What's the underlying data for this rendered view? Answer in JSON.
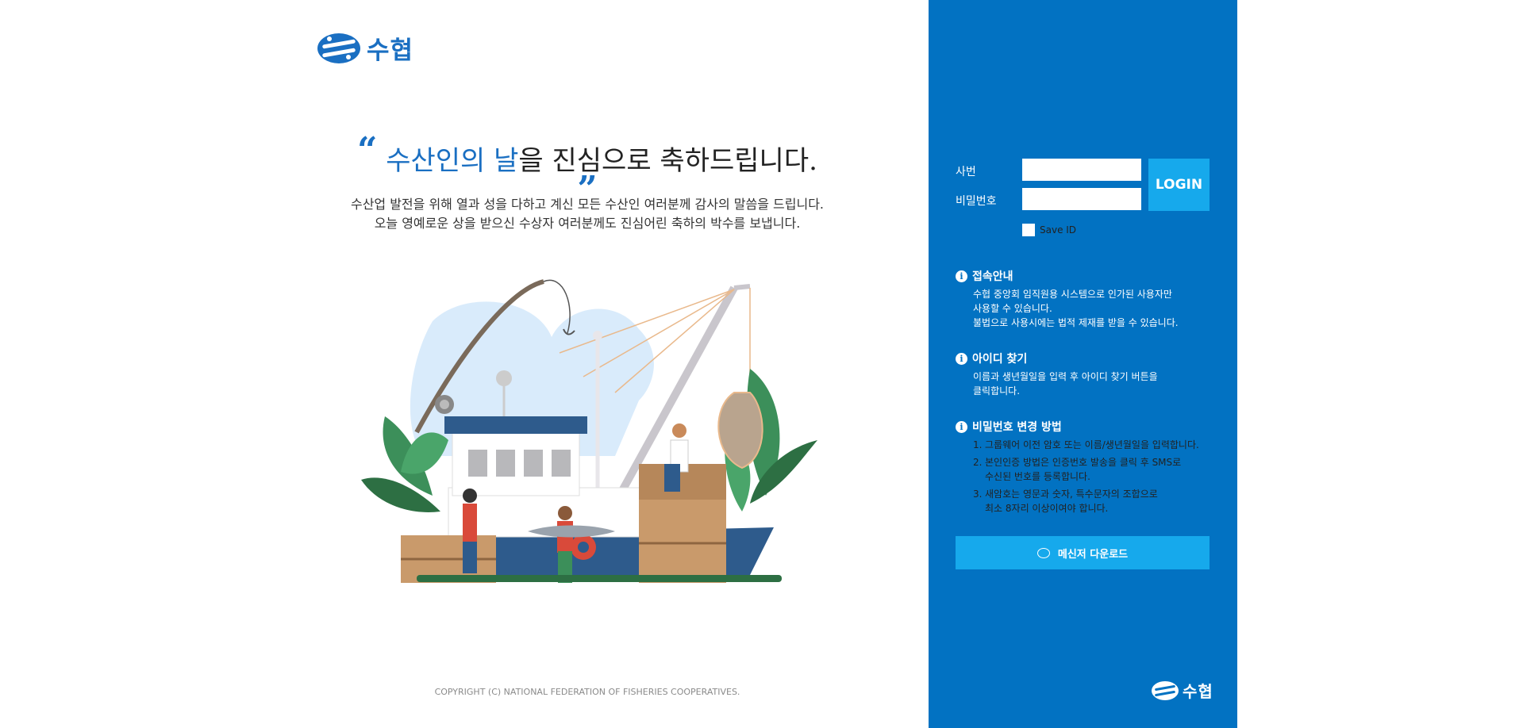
{
  "brand": {
    "logo_text": "수협",
    "primary_color": "#1a6fc2",
    "panel_color": "#0272c2",
    "button_color": "#16a9ec"
  },
  "headline": {
    "accent": "수산인의 날",
    "rest": "을 진심으로 축하드립니다."
  },
  "subtext": {
    "line1": "수산업 발전을 위해 열과 성을 다하고 계신 모든 수산인 여러분께 감사의 말씀을 드립니다.",
    "line2": "오늘 영예로운 상을 받으신 수상자 여러분께도 진심어린 축하의 박수를 보냅니다."
  },
  "illustration": {
    "icon": "fishing-boat-illustration"
  },
  "footer": {
    "copyright": "COPYRIGHT (C) NATIONAL FEDERATION OF FISHERIES COOPERATIVES."
  },
  "login": {
    "id_label": "사번",
    "password_label": "비밀번호",
    "id_value": "",
    "password_value": "",
    "login_button": "LOGIN",
    "save_id_label": "Save ID",
    "save_id_checked": false
  },
  "sections": {
    "access": {
      "title": "접속안내",
      "lines": [
        "수협 중앙회 임직원용 시스템으로 인가된 사용자만",
        "사용할 수 있습니다.",
        "불법으로 사용시에는 법적 제재를 받을 수 있습니다."
      ]
    },
    "find_id": {
      "title": "아이디 찾기",
      "lines": [
        "이름과 생년월일을 입력 후 아이디 찾기 버튼을",
        "클릭합니다."
      ]
    },
    "password_change": {
      "title": "비밀번호 변경 방법",
      "items": [
        {
          "num": "1.",
          "lines": [
            "그룹웨어 이전 암호 또는 이름/생년월일을 입력합니다."
          ]
        },
        {
          "num": "2.",
          "lines": [
            "본인인증 방법은 인증번호 발송을 클릭 후 SMS로",
            "수신된 번호를 등록합니다."
          ]
        },
        {
          "num": "3.",
          "lines": [
            "새암호는 영문과 숫자, 특수문자의 조합으로",
            "최소 8자리 이상이여야 합니다."
          ]
        }
      ]
    }
  },
  "download": {
    "label": "메신저 다운로드",
    "icon": "chat-bubble-icon"
  }
}
